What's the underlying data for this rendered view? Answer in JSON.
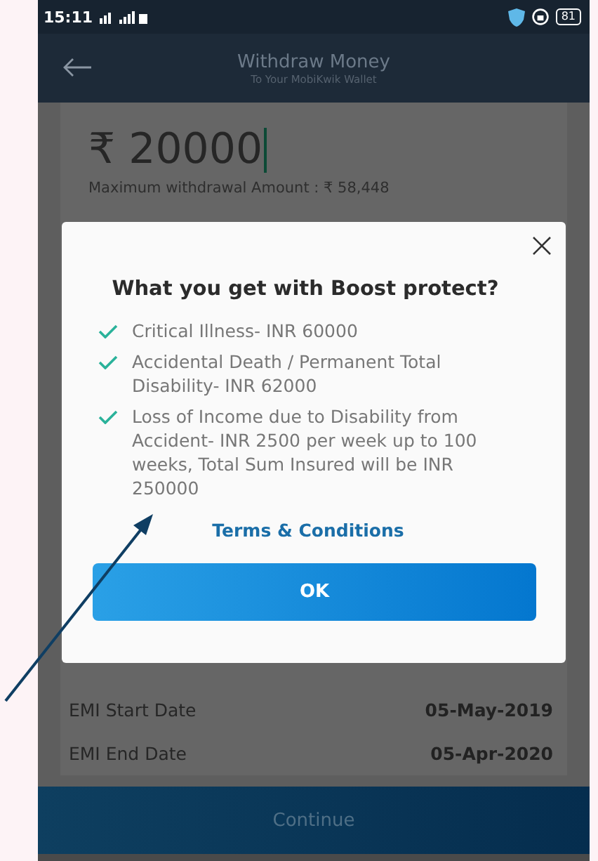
{
  "status_bar": {
    "time": "15:11",
    "battery": "81"
  },
  "header": {
    "title": "Withdraw Money",
    "subtitle": "To Your MobiKwik Wallet"
  },
  "amount": {
    "value": "₹ 20000",
    "hint": "Maximum withdrawal Amount : ₹ 58,448"
  },
  "emi_rows": [
    {
      "label": "EMI Start Date",
      "value": "05-May-2019"
    },
    {
      "label": "EMI End Date",
      "value": "05-Apr-2020"
    }
  ],
  "continue_button": "Continue",
  "dialog": {
    "title": "What you get with Boost protect?",
    "benefits": [
      "Critical Illness- INR 60000",
      "Accidental Death / Permanent Total Disability- INR 62000",
      "Loss of Income due to Disability from Accident- INR 2500 per week up to 100 weeks, Total Sum Insured will be INR 250000"
    ],
    "link": "Terms & Conditions",
    "ok_button": "OK"
  }
}
